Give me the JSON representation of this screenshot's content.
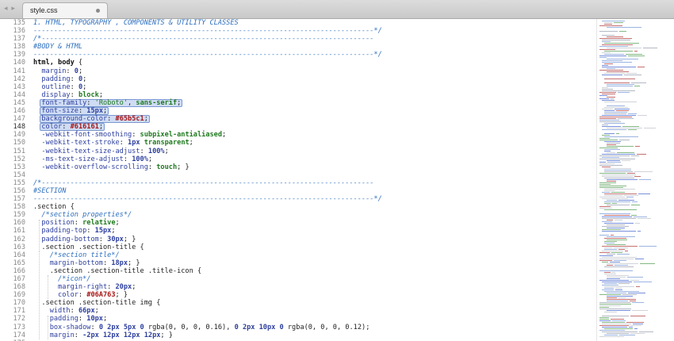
{
  "tabbar": {
    "nav_arrows": "◂ ▸",
    "tab_title": "style.css"
  },
  "icons": {
    "back": "chevron-left-icon",
    "forward": "chevron-right-icon",
    "unsaved": "dot-icon"
  },
  "lines": [
    {
      "n": "135",
      "seg": [
        [
          "c",
          "1. HTML, TYPOGRAPHY , COMPONENTS & UTILITY CLASSES"
        ]
      ]
    },
    {
      "n": "136",
      "seg": [
        [
          "c",
          "-----------------------------------------------------------------------------------*/"
        ]
      ]
    },
    {
      "n": "137",
      "seg": [
        [
          "c",
          "/*---------------------------------------------------------------------------------"
        ]
      ]
    },
    {
      "n": "138",
      "seg": [
        [
          "c",
          "#BODY & HTML"
        ]
      ]
    },
    {
      "n": "139",
      "seg": [
        [
          "c",
          "-----------------------------------------------------------------------------------*/"
        ]
      ]
    },
    {
      "n": "140",
      "seg": [
        [
          "s",
          "html, body"
        ],
        [
          "t",
          " {"
        ]
      ]
    },
    {
      "n": "141",
      "seg": [
        [
          "t",
          "  "
        ],
        [
          "p",
          "margin"
        ],
        [
          "t",
          ": "
        ],
        [
          "n",
          "0"
        ],
        [
          "t",
          ";"
        ]
      ]
    },
    {
      "n": "142",
      "seg": [
        [
          "t",
          "  "
        ],
        [
          "p",
          "padding"
        ],
        [
          "t",
          ": "
        ],
        [
          "n",
          "0"
        ],
        [
          "t",
          ";"
        ]
      ]
    },
    {
      "n": "143",
      "seg": [
        [
          "t",
          "  "
        ],
        [
          "p",
          "outline"
        ],
        [
          "t",
          ": "
        ],
        [
          "n",
          "0"
        ],
        [
          "t",
          ";"
        ]
      ]
    },
    {
      "n": "144",
      "seg": [
        [
          "t",
          "  "
        ],
        [
          "p",
          "display"
        ],
        [
          "t",
          ": "
        ],
        [
          "v",
          "block"
        ],
        [
          "t",
          ";"
        ]
      ]
    },
    {
      "n": "145",
      "seg": [
        [
          "t",
          "  "
        ],
        [
          "p",
          "font-family"
        ],
        [
          "t",
          ": "
        ],
        [
          "g",
          "'Roboto'"
        ],
        [
          "t",
          ", "
        ],
        [
          "v",
          "sans-serif"
        ],
        [
          "t",
          ";"
        ]
      ]
    },
    {
      "n": "146",
      "seg": [
        [
          "t",
          "  "
        ],
        [
          "p",
          "font-size"
        ],
        [
          "t",
          ": "
        ],
        [
          "n",
          "15px"
        ],
        [
          "t",
          ";"
        ]
      ]
    },
    {
      "n": "147",
      "seg": [
        [
          "t",
          "  "
        ],
        [
          "p",
          "background-color"
        ],
        [
          "t",
          ": "
        ],
        [
          "h",
          "#65b5c1"
        ],
        [
          "t",
          ";"
        ]
      ]
    },
    {
      "n": "148",
      "seg": [
        [
          "t",
          "  "
        ],
        [
          "p",
          "color"
        ],
        [
          "t",
          ": "
        ],
        [
          "h",
          "#616161"
        ],
        [
          "t",
          ";"
        ]
      ]
    },
    {
      "n": "149",
      "seg": [
        [
          "t",
          "  "
        ],
        [
          "p",
          "-webkit-font-smoothing"
        ],
        [
          "t",
          ": "
        ],
        [
          "v",
          "subpixel-antialiased"
        ],
        [
          "t",
          ";"
        ]
      ]
    },
    {
      "n": "150",
      "seg": [
        [
          "t",
          "  "
        ],
        [
          "p",
          "-webkit-text-stroke"
        ],
        [
          "t",
          ": "
        ],
        [
          "n",
          "1px"
        ],
        [
          "t",
          " "
        ],
        [
          "v",
          "transparent"
        ],
        [
          "t",
          ";"
        ]
      ]
    },
    {
      "n": "151",
      "seg": [
        [
          "t",
          "  "
        ],
        [
          "p",
          "-webkit-text-size-adjust"
        ],
        [
          "t",
          ": "
        ],
        [
          "n",
          "100%"
        ],
        [
          "t",
          ";"
        ]
      ]
    },
    {
      "n": "152",
      "seg": [
        [
          "t",
          "  "
        ],
        [
          "p",
          "-ms-text-size-adjust"
        ],
        [
          "t",
          ": "
        ],
        [
          "n",
          "100%"
        ],
        [
          "t",
          ";"
        ]
      ]
    },
    {
      "n": "153",
      "seg": [
        [
          "t",
          "  "
        ],
        [
          "p",
          "-webkit-overflow-scrolling"
        ],
        [
          "t",
          ": "
        ],
        [
          "v",
          "touch"
        ],
        [
          "t",
          "; }"
        ]
      ]
    },
    {
      "n": "154",
      "seg": []
    },
    {
      "n": "155",
      "seg": [
        [
          "c",
          "/*---------------------------------------------------------------------------------"
        ]
      ]
    },
    {
      "n": "156",
      "seg": [
        [
          "c",
          "#SECTION"
        ]
      ]
    },
    {
      "n": "157",
      "seg": [
        [
          "c",
          "-----------------------------------------------------------------------------------*/"
        ]
      ]
    },
    {
      "n": "158",
      "seg": [
        [
          "t",
          ".section {"
        ]
      ]
    },
    {
      "n": "159",
      "seg": [
        [
          "t",
          "  "
        ],
        [
          "c",
          "/*section properties*/"
        ]
      ]
    },
    {
      "n": "160",
      "seg": [
        [
          "t",
          "  "
        ],
        [
          "p",
          "position"
        ],
        [
          "t",
          ": "
        ],
        [
          "v",
          "relative"
        ],
        [
          "t",
          ";"
        ]
      ]
    },
    {
      "n": "161",
      "seg": [
        [
          "t",
          "  "
        ],
        [
          "p",
          "padding-top"
        ],
        [
          "t",
          ": "
        ],
        [
          "n",
          "15px"
        ],
        [
          "t",
          ";"
        ]
      ]
    },
    {
      "n": "162",
      "seg": [
        [
          "t",
          "  "
        ],
        [
          "p",
          "padding-bottom"
        ],
        [
          "t",
          ": "
        ],
        [
          "n",
          "30px"
        ],
        [
          "t",
          "; }"
        ]
      ]
    },
    {
      "n": "163",
      "seg": [
        [
          "t",
          "  .section .section-title {"
        ]
      ]
    },
    {
      "n": "164",
      "seg": [
        [
          "t",
          "    "
        ],
        [
          "c",
          "/*section title*/"
        ]
      ]
    },
    {
      "n": "165",
      "seg": [
        [
          "t",
          "    "
        ],
        [
          "p",
          "margin-bottom"
        ],
        [
          "t",
          ": "
        ],
        [
          "n",
          "18px"
        ],
        [
          "t",
          "; }"
        ]
      ]
    },
    {
      "n": "166",
      "seg": [
        [
          "t",
          "    .section .section-title .title-icon {"
        ]
      ]
    },
    {
      "n": "167",
      "seg": [
        [
          "t",
          "      "
        ],
        [
          "c",
          "/*icon*/"
        ]
      ]
    },
    {
      "n": "168",
      "seg": [
        [
          "t",
          "      "
        ],
        [
          "p",
          "margin-right"
        ],
        [
          "t",
          ": "
        ],
        [
          "n",
          "20px"
        ],
        [
          "t",
          ";"
        ]
      ]
    },
    {
      "n": "169",
      "seg": [
        [
          "t",
          "      "
        ],
        [
          "p",
          "color"
        ],
        [
          "t",
          ": "
        ],
        [
          "h",
          "#06A763"
        ],
        [
          "t",
          "; }"
        ]
      ]
    },
    {
      "n": "170",
      "seg": [
        [
          "t",
          "  .section .section-title img {"
        ]
      ]
    },
    {
      "n": "171",
      "seg": [
        [
          "t",
          "    "
        ],
        [
          "p",
          "width"
        ],
        [
          "t",
          ": "
        ],
        [
          "n",
          "66px"
        ],
        [
          "t",
          ";"
        ]
      ]
    },
    {
      "n": "172",
      "seg": [
        [
          "t",
          "    "
        ],
        [
          "p",
          "padding"
        ],
        [
          "t",
          ": "
        ],
        [
          "n",
          "10px"
        ],
        [
          "t",
          ";"
        ]
      ]
    },
    {
      "n": "173",
      "seg": [
        [
          "t",
          "    "
        ],
        [
          "p",
          "box-shadow"
        ],
        [
          "t",
          ": "
        ],
        [
          "n",
          "0 2px 5px 0"
        ],
        [
          "t",
          " "
        ],
        [
          "r",
          "rgba(0, 0, 0, 0.16)"
        ],
        [
          "t",
          ", "
        ],
        [
          "n",
          "0 2px 10px 0"
        ],
        [
          "t",
          " "
        ],
        [
          "r",
          "rgba(0, 0, 0, 0.12)"
        ],
        [
          "t",
          ";"
        ]
      ]
    },
    {
      "n": "174",
      "seg": [
        [
          "t",
          "    "
        ],
        [
          "p",
          "margin"
        ],
        [
          "t",
          ": "
        ],
        [
          "n",
          "-2px 12px 12px 12px"
        ],
        [
          "t",
          "; }"
        ]
      ]
    },
    {
      "n": "175",
      "seg": []
    }
  ],
  "current_line": "148",
  "selection_lines": [
    "145",
    "146",
    "147",
    "148"
  ],
  "colors": {
    "selection_bg": "#cfdcf4",
    "selection_border": "#7b98d1",
    "comment": "#2d6fbf",
    "string": "#1f7a1f",
    "hex": "#a81616"
  }
}
